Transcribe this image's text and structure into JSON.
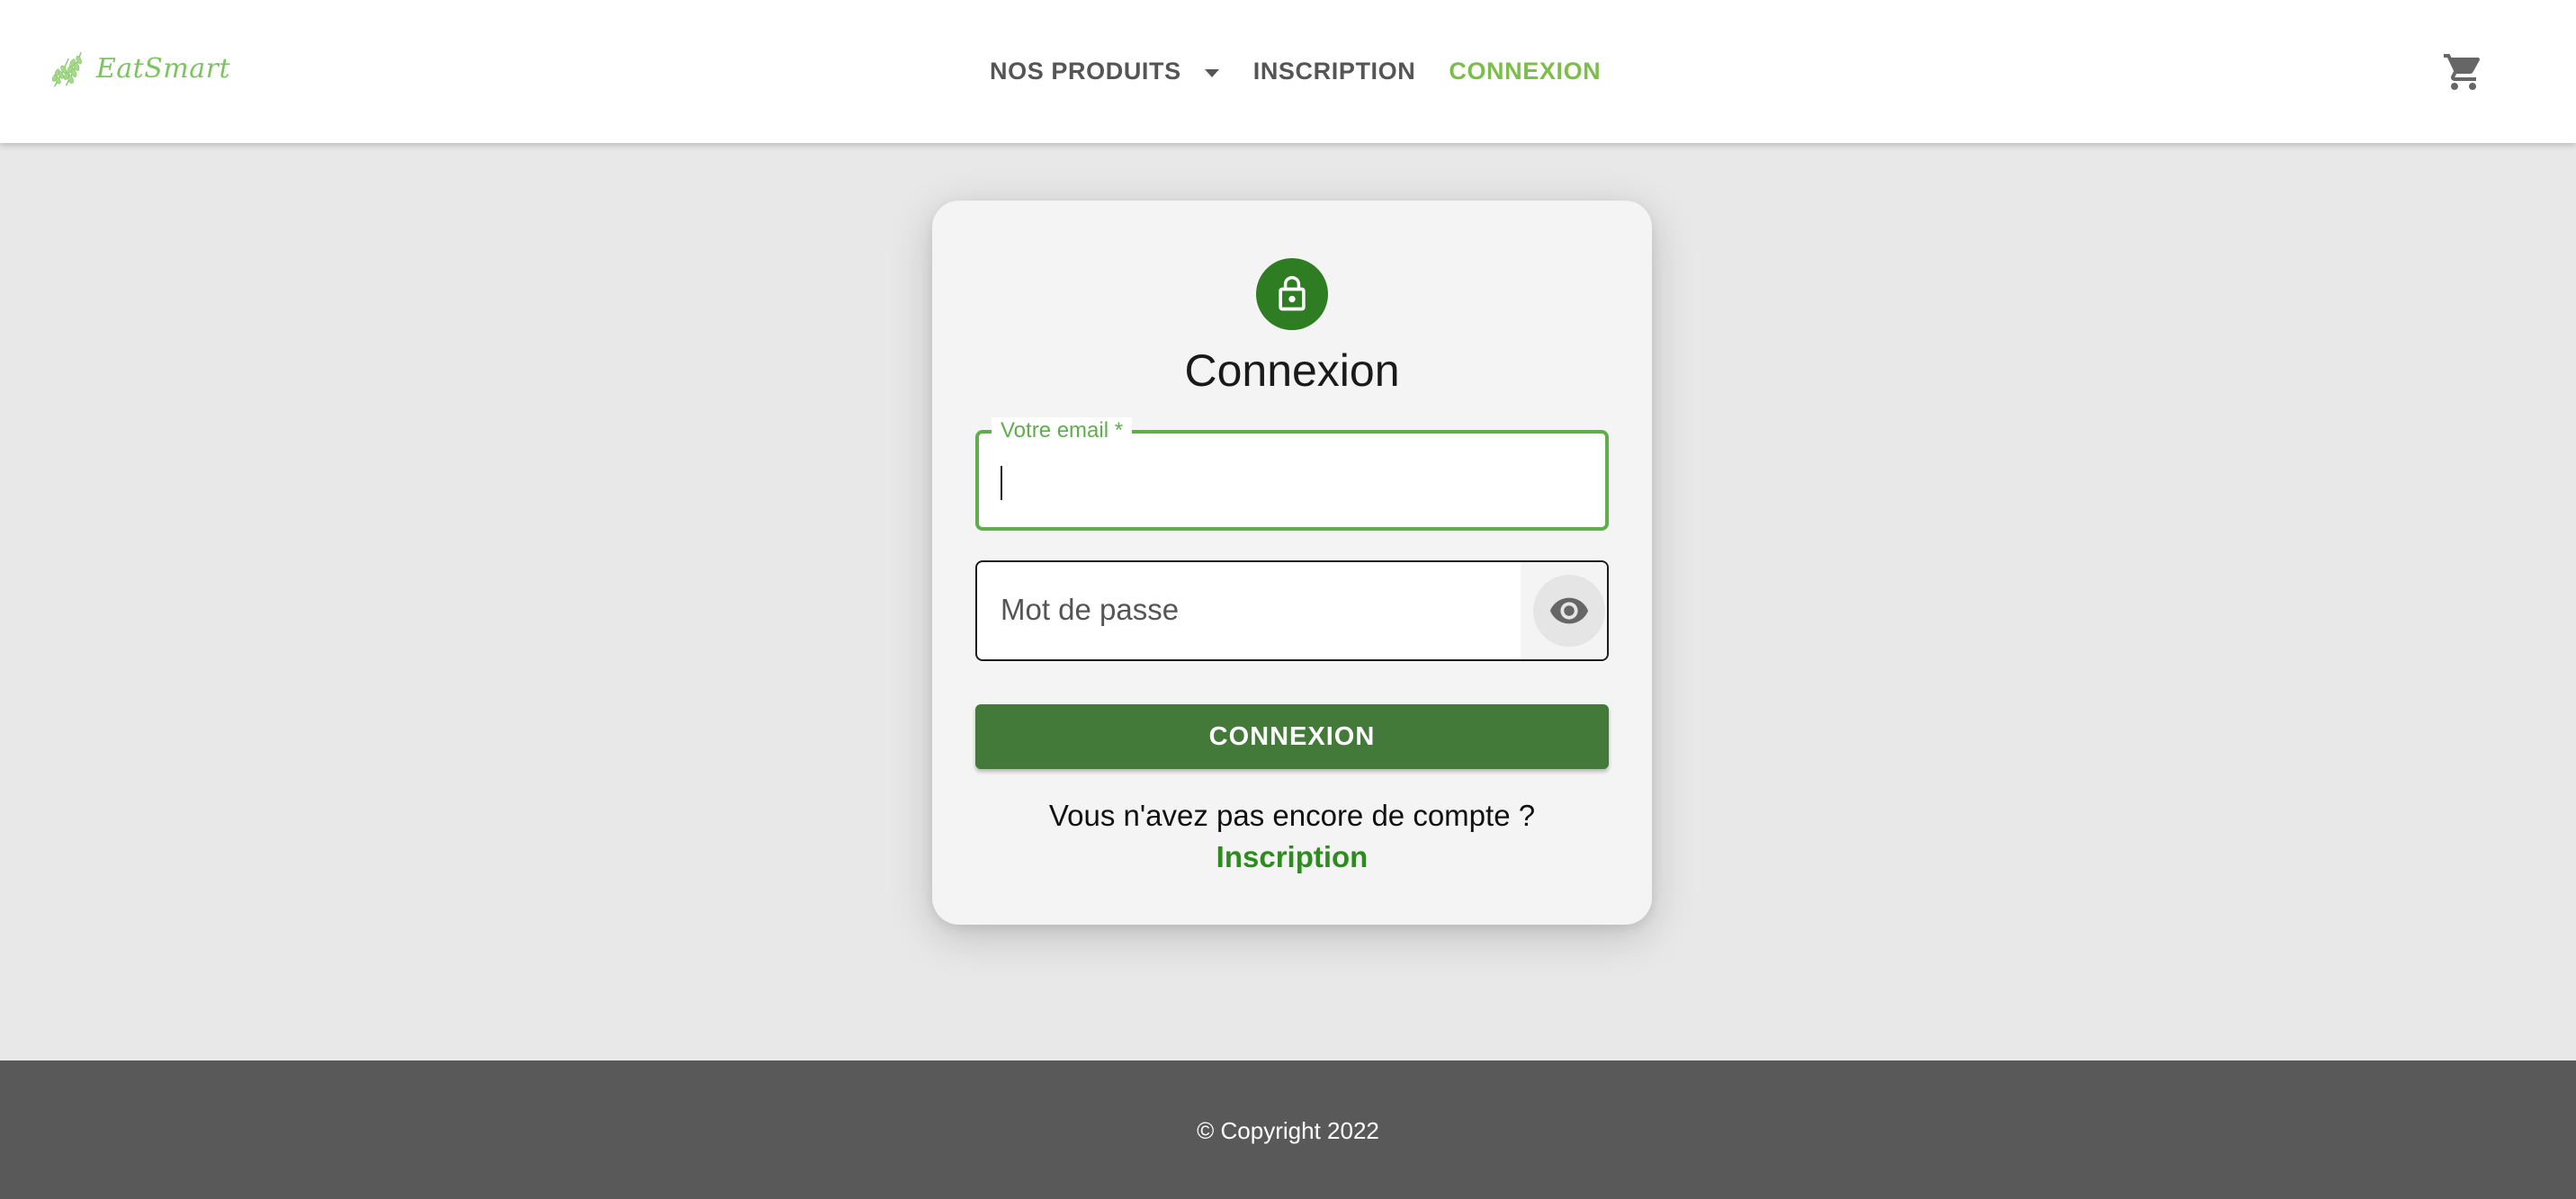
{
  "app": {
    "logo_text": "EatSmart"
  },
  "nav": {
    "items": [
      {
        "label": "NOS PRODUITS",
        "has_dropdown": true,
        "active": false
      },
      {
        "label": "INSCRIPTION",
        "has_dropdown": false,
        "active": false
      },
      {
        "label": "CONNEXION",
        "has_dropdown": false,
        "active": true
      }
    ],
    "cart_icon": "shopping-cart-icon"
  },
  "login_card": {
    "icon": "lock-icon",
    "title": "Connexion",
    "email_field": {
      "label": "Votre email  *",
      "value": ""
    },
    "password_field": {
      "placeholder": "Mot de passe",
      "visibility_icon": "eye-icon"
    },
    "submit_label": "CONNEXION",
    "signup_prompt": "Vous n'avez pas encore de compte ?",
    "signup_link": "Inscription"
  },
  "footer": {
    "copyright": "© Copyright 2022"
  },
  "colors": {
    "brand_green": "#7cbe4a",
    "dark_green": "#2e7d22",
    "button_green": "#437a39",
    "footer_bg": "#595959",
    "page_bg": "#e8e8e8"
  }
}
